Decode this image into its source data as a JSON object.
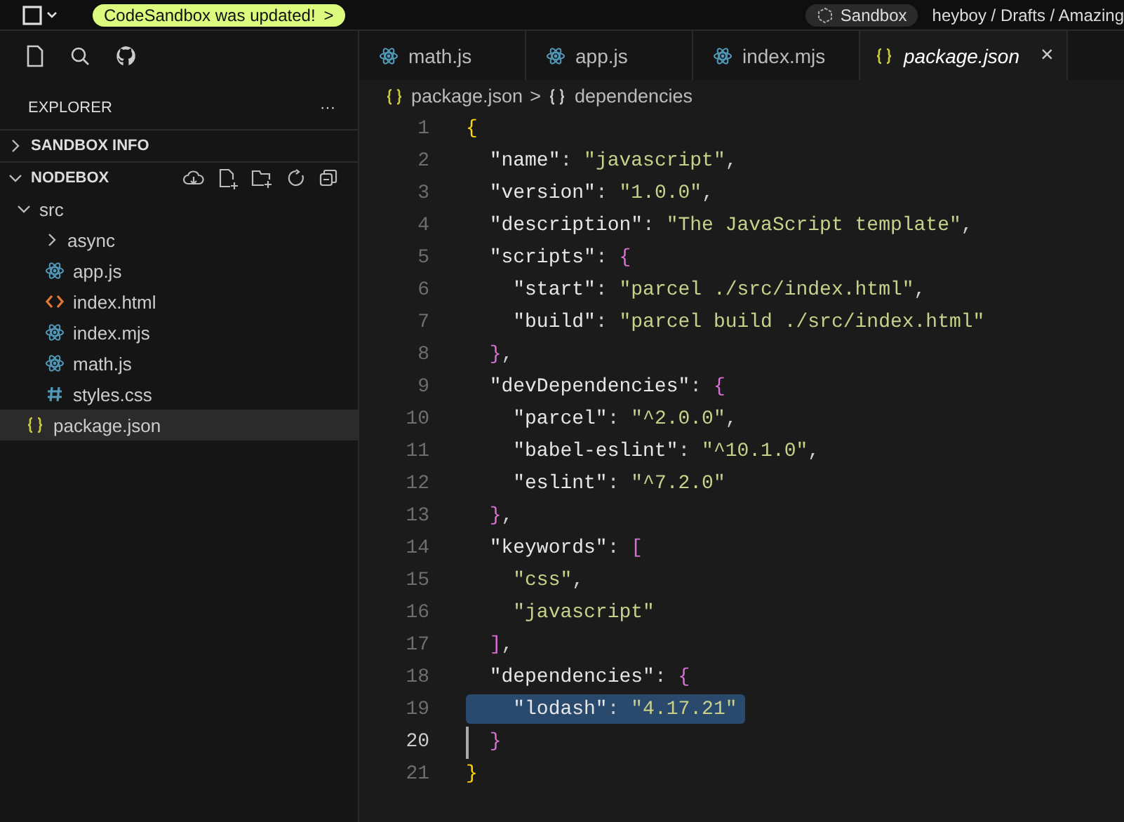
{
  "top_bar": {
    "notice": "CodeSandbox was updated!",
    "notice_arrow": ">",
    "chip": "Sandbox",
    "path": "heyboy / Drafts / Amazing"
  },
  "sidebar": {
    "title": "EXPLORER",
    "more": "···",
    "sections": [
      {
        "label": "SANDBOX INFO",
        "expanded": false
      },
      {
        "label": "NODEBOX",
        "expanded": true
      }
    ],
    "tree": [
      {
        "label": "src",
        "kind": "folder",
        "expanded": true,
        "selected": false,
        "children": [
          {
            "label": "async",
            "kind": "folder",
            "expanded": false,
            "selected": false
          },
          {
            "label": "app.js",
            "kind": "react",
            "selected": false
          },
          {
            "label": "index.html",
            "kind": "html",
            "selected": false
          },
          {
            "label": "index.mjs",
            "kind": "react",
            "selected": false
          },
          {
            "label": "math.js",
            "kind": "react",
            "selected": false
          },
          {
            "label": "styles.css",
            "kind": "css",
            "selected": false
          }
        ]
      },
      {
        "label": "package.json",
        "kind": "json",
        "selected": true
      }
    ]
  },
  "tabs": [
    {
      "label": "math.js",
      "kind": "react",
      "selected": false
    },
    {
      "label": "app.js",
      "kind": "react",
      "selected": false
    },
    {
      "label": "index.mjs",
      "kind": "react",
      "selected": false
    },
    {
      "label": "package.json",
      "kind": "json",
      "selected": true,
      "close": "×"
    }
  ],
  "breadcrumb": [
    {
      "label": "package.json",
      "kind": "json"
    },
    {
      "label": "dependencies",
      "kind": "object"
    }
  ],
  "breadcrumb_sep": ">",
  "lines": [
    {
      "number": "1",
      "text": "{"
    },
    {
      "number": "2",
      "text": "  \"name\": \"javascript\","
    },
    {
      "number": "3",
      "text": "  \"version\": \"1.0.0\","
    },
    {
      "number": "4",
      "text": "  \"description\": \"The JavaScript template\","
    },
    {
      "number": "5",
      "text": "  \"scripts\": {"
    },
    {
      "number": "6",
      "text": "    \"start\": \"parcel ./src/index.html\","
    },
    {
      "number": "7",
      "text": "    \"build\": \"parcel build ./src/index.html\""
    },
    {
      "number": "8",
      "text": "  },"
    },
    {
      "number": "9",
      "text": "  \"devDependencies\": {"
    },
    {
      "number": "10",
      "text": "    \"parcel\": \"^2.0.0\","
    },
    {
      "number": "11",
      "text": "    \"babel-eslint\": \"^10.1.0\","
    },
    {
      "number": "12",
      "text": "    \"eslint\": \"^7.2.0\""
    },
    {
      "number": "13",
      "text": "  },"
    },
    {
      "number": "14",
      "text": "  \"keywords\": ["
    },
    {
      "number": "15",
      "text": "    \"css\","
    },
    {
      "number": "16",
      "text": "    \"javascript\""
    },
    {
      "number": "17",
      "text": "  ],"
    },
    {
      "number": "18",
      "text": "  \"dependencies\": {"
    },
    {
      "number": "19",
      "text": "    \"lodash\": \"4.17.21\"",
      "selected": true
    },
    {
      "number": "20",
      "text": "  }",
      "current": true
    },
    {
      "number": "21",
      "text": "}"
    }
  ]
}
